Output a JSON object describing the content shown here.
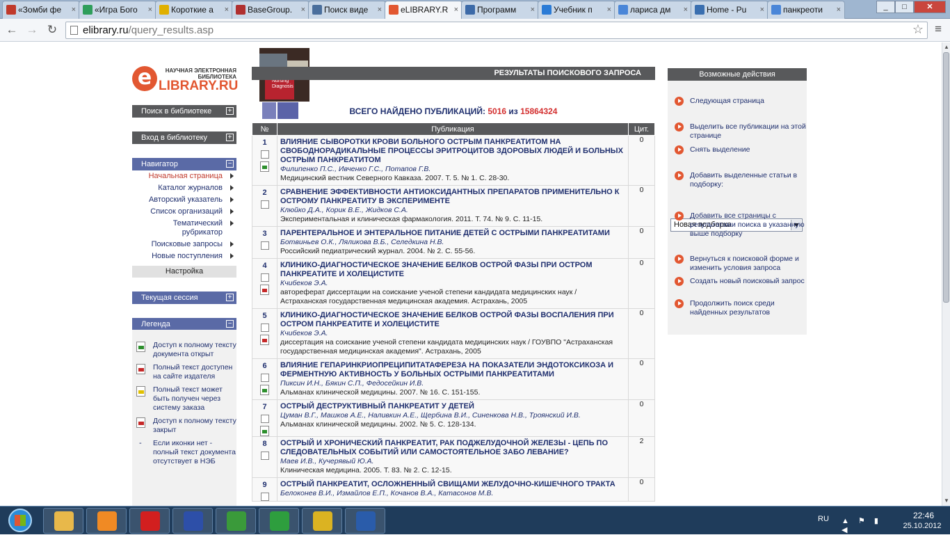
{
  "browser": {
    "tabs": [
      {
        "label": "«Зомби фе",
        "icon": "video-icon",
        "color": "#c0392b"
      },
      {
        "label": "«Игра Бого",
        "icon": "gem-icon",
        "color": "#2e9e5b"
      },
      {
        "label": "Короткие а",
        "icon": "smiley-icon",
        "color": "#e0b000"
      },
      {
        "label": "BaseGroup.",
        "icon": "basegroup-icon",
        "color": "#b03030"
      },
      {
        "label": "Поиск виде",
        "icon": "vk-icon",
        "color": "#4a6e9c"
      },
      {
        "label": "eLIBRARY.R",
        "icon": "elibrary-icon",
        "color": "#e25731",
        "active": true
      },
      {
        "label": "Программ",
        "icon": "eye-icon",
        "color": "#3c6aa8"
      },
      {
        "label": "Учебник п",
        "icon": "star-icon",
        "color": "#2b7bd6"
      },
      {
        "label": "лариса дм",
        "icon": "google-icon",
        "color": "#4a86d8"
      },
      {
        "label": "Home - Pu",
        "icon": "cloud-icon",
        "color": "#3a6fb0"
      },
      {
        "label": "панкреоти",
        "icon": "google-icon",
        "color": "#4a86d8"
      }
    ],
    "url_host": "elibrary.ru",
    "url_path": "/query_results.asp"
  },
  "logo": {
    "tagline": "НАУЧНАЯ ЭЛЕКТРОННАЯ БИБЛИОТЕКА",
    "name": "LIBRARY.RU",
    "letter": "e"
  },
  "sidebar": {
    "search_block": "Поиск в библиотеке",
    "login_block": "Вход в библиотеку",
    "navigator_block": "Навигатор",
    "nav_items": [
      {
        "label": "Начальная страница",
        "current": true
      },
      {
        "label": "Каталог журналов"
      },
      {
        "label": "Авторский указатель"
      },
      {
        "label": "Список организаций"
      },
      {
        "label": "Тематический рубрикатор"
      },
      {
        "label": "Поисковые запросы"
      },
      {
        "label": "Новые поступления"
      }
    ],
    "settings": "Настройка",
    "session_block": "Текущая сессия",
    "legend_block": "Легенда",
    "legend_items": [
      {
        "text": "Доступ к полному тексту документа открыт",
        "icon": "green"
      },
      {
        "text": "Полный текст доступен на сайте издателя",
        "icon": "red"
      },
      {
        "text": "Полный текст может быть получен через систему заказа",
        "icon": "yellow"
      },
      {
        "text": "Доступ к полному тексту закрыт",
        "icon": "redx"
      },
      {
        "text": "Если иконки нет - полный текст документа отсутствует в НЭБ",
        "icon": "dash"
      }
    ]
  },
  "main": {
    "results_title": "РЕЗУЛЬТАТЫ ПОИСКОВОГО ЗАПРОСА",
    "photo_caption": "Nursing Diagnosis",
    "total_label": "ВСЕГО НАЙДЕНО ПУБЛИКАЦИЙ:",
    "total_found": "5016",
    "total_of": "из",
    "total_all": "15864324",
    "columns": {
      "num": "№",
      "pub": "Публикация",
      "cit": "Цит."
    },
    "rows": [
      {
        "n": "1",
        "title": "ВЛИЯНИЕ СЫВОРОТКИ КРОВИ БОЛЬНОГО ОСТРЫМ ПАНКРЕАТИТОМ НА СВОБОДНОРАДИКАЛЬНЫЕ ПРОЦЕССЫ ЭРИТРОЦИТОВ ЗДОРОВЫХ ЛЮДЕЙ И БОЛЬНЫХ ОСТРЫМ ПАНКРЕАТИТОМ",
        "authors": "Филипенко П.С., Ивченко Г.С., Потапов Г.В.",
        "source": "Медицинский вестник Северного Кавказа. 2007. Т. 5. № 1. С. 28-30.",
        "cit": "0",
        "pdf": "green"
      },
      {
        "n": "2",
        "title": "СРАВНЕНИЕ ЭФФЕКТИВНОСТИ АНТИОКСИДАНТНЫХ ПРЕПАРАТОВ ПРИМЕНИТЕЛЬНО К ОСТРОМУ ПАНКРЕАТИТУ В ЭКСПЕРИМЕНТЕ",
        "authors": "Клюйко Д.А., Корик В.Е., Жидков С.А.",
        "source": "Экспериментальная и клиническая фармакология. 2011. Т. 74. № 9. С. 11-15.",
        "cit": "0",
        "pdf": ""
      },
      {
        "n": "3",
        "title": "ПАРЕНТЕРАЛЬНОЕ И ЭНТЕРАЛЬНОЕ ПИТАНИЕ ДЕТЕЙ С ОСТРЫМИ ПАНКРЕАТИТАМИ",
        "authors": "Ботвиньев О.К., Ляликова В.Б., Селедкина Н.В.",
        "source": "Российский педиатрический журнал. 2004. № 2. С. 55-56.",
        "cit": "0",
        "pdf": ""
      },
      {
        "n": "4",
        "title": "КЛИНИКО-ДИАГНОСТИЧЕСКОЕ ЗНАЧЕНИЕ БЕЛКОВ ОСТРОЙ ФАЗЫ ПРИ ОСТРОМ ПАНКРЕАТИТЕ И ХОЛЕЦИСТИТЕ",
        "authors": "Кчибеков Э.А.",
        "source": "автореферат диссертации на соискание ученой степени кандидата медицинских наук / Астраханская государственная медицинская академия. Астрахань, 2005",
        "cit": "0",
        "pdf": "red"
      },
      {
        "n": "5",
        "title": "КЛИНИКО-ДИАГНОСТИЧЕСКОЕ ЗНАЧЕНИЕ БЕЛКОВ ОСТРОЙ ФАЗЫ ВОСПАЛЕНИЯ ПРИ ОСТРОМ ПАНКРЕАТИТЕ И ХОЛЕЦИСТИТЕ",
        "authors": "Кчибеков Э.А.",
        "source": "диссертация на соискание ученой степени кандидата медицинских наук / ГОУВПО \"Астраханская государственная медицинская академия\". Астрахань, 2005",
        "cit": "0",
        "pdf": "red"
      },
      {
        "n": "6",
        "title": "ВЛИЯНИЕ ГЕПАРИНКРИОПРЕЦИПИТАТАФЕРЕЗА НА ПОКАЗАТЕЛИ ЭНДОТОКСИКОЗА И ФЕРМЕНТНУЮ АКТИВНОСТЬ У БОЛЬНЫХ ОСТРЫМИ ПАНКРЕАТИТАМИ",
        "authors": "Пиксин И.Н., Бякин С.П., Федосейкин И.В.",
        "source": "Альманах клинической медицины. 2007. № 16. С. 151-155.",
        "cit": "0",
        "pdf": "green"
      },
      {
        "n": "7",
        "title": "ОСТРЫЙ ДЕСТРУКТИВНЫЙ ПАНКРЕАТИТ У ДЕТЕЙ",
        "authors": "Цуман В.Г., Машков А.Е., Наливкин А.Е., Щербина В.И., Синенкова Н.В., Троянский И.В.",
        "source": "Альманах клинической медицины. 2002. № 5. С. 128-134.",
        "cit": "0",
        "pdf": "green"
      },
      {
        "n": "8",
        "title": "ОСТРЫЙ И ХРОНИЧЕСКИЙ ПАНКРЕАТИТ, РАК ПОДЖЕЛУДОЧНОЙ ЖЕЛЕЗЫ - ЦЕПЬ ПО СЛЕДОВАТЕЛЬНЫХ СОБЫТИЙ ИЛИ САМОСТОЯТЕЛЬНОЕ ЗАБО ЛЕВАНИЕ?",
        "authors": "Маев И.В., Кучерявый Ю.А.",
        "source": "Клиническая медицина. 2005. Т. 83. № 2. С. 12-15.",
        "cit": "2",
        "pdf": ""
      },
      {
        "n": "9",
        "title": "ОСТРЫЙ ПАНКРЕАТИТ, ОСЛОЖНЕННЫЙ СВИЩАМИ ЖЕЛУДОЧНО-КИШЕЧНОГО ТРАКТА",
        "authors": "Белоконев В.И., Измайлов Е.П., Кочанов В.А., Катасонов М.В.",
        "source": "",
        "cit": "0",
        "pdf": ""
      }
    ]
  },
  "actions": {
    "header": "Возможные действия",
    "next_page": "Следующая страница",
    "select_all": "Выделить все публикации на этой странице",
    "deselect": "Снять выделение",
    "add_selected": "Добавить выделенные статьи в подборку:",
    "collection_value": "Новая подборка",
    "add_all_pages": "Добавить все страницы с результатами поиска в указанную выше подборку",
    "back_to_form": "Вернуться к поисковой форме и изменить условия запроса",
    "new_query": "Создать новый поисковый запрос",
    "search_within": "Продолжить поиск среди найденных результатов"
  },
  "taskbar": {
    "lang": "RU",
    "time": "22:46",
    "date": "25.10.2012",
    "apps": [
      {
        "icon": "explorer-icon",
        "color": "#e8b84a"
      },
      {
        "icon": "aimp-icon",
        "color": "#f08a24"
      },
      {
        "icon": "opera-icon",
        "color": "#d21f1f"
      },
      {
        "icon": "floppy-save-icon",
        "color": "#2d4fa8"
      },
      {
        "icon": "utorrent-icon",
        "color": "#3a9a3a"
      },
      {
        "icon": "mail-agent-icon",
        "color": "#2e9e3e"
      },
      {
        "icon": "chrome-icon",
        "color": "#dbb322"
      },
      {
        "icon": "word-icon",
        "color": "#2a5caa"
      }
    ]
  }
}
